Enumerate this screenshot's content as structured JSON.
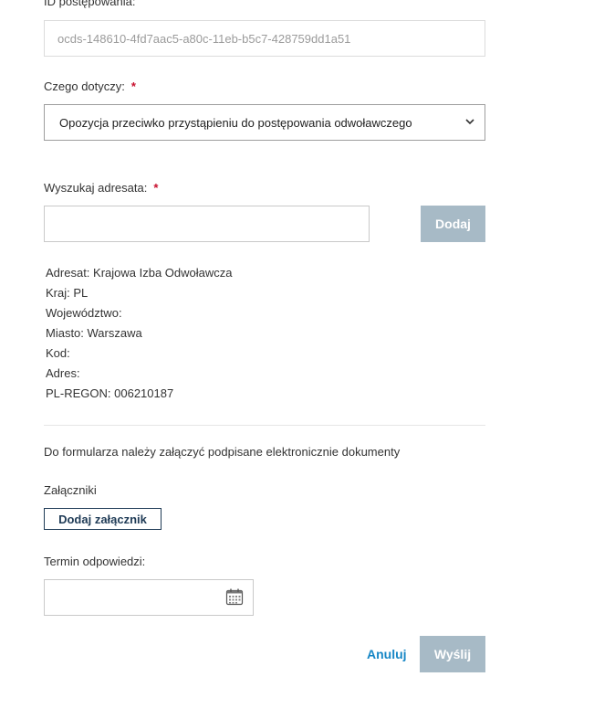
{
  "form": {
    "id_label": "ID postępowania:",
    "id_value": "ocds-148610-4fd7aac5-a80c-11eb-b5c7-428759dd1a51",
    "subject_label": "Czego dotyczy:",
    "required_mark": "*",
    "subject_value": "Opozycja przeciwko przystąpieniu do postępowania odwoławczego",
    "search_label": "Wyszukaj adresata:",
    "search_value": "",
    "add_button": "Dodaj",
    "recipient": [
      "Adresat: Krajowa Izba Odwoławcza",
      "Kraj: PL",
      "Województwo:",
      "Miasto: Warszawa",
      "Kod:",
      "Adres:",
      "PL-REGON: 006210187"
    ],
    "attach_note": "Do formularza należy załączyć podpisane elektronicznie dokumenty",
    "attachments_label": "Załączniki",
    "add_attachment_button": "Dodaj załącznik",
    "deadline_label": "Termin odpowiedzi:",
    "deadline_value": "",
    "cancel_button": "Anuluj",
    "submit_button": "Wyślij"
  },
  "colors": {
    "accent_link": "#1787c6",
    "disabled_button": "#a7bac6",
    "required": "#c8102e",
    "outline_button": "#1f3b56"
  },
  "icons": {
    "select_chevron": "chevron-down-icon",
    "date_picker": "calendar-icon"
  }
}
